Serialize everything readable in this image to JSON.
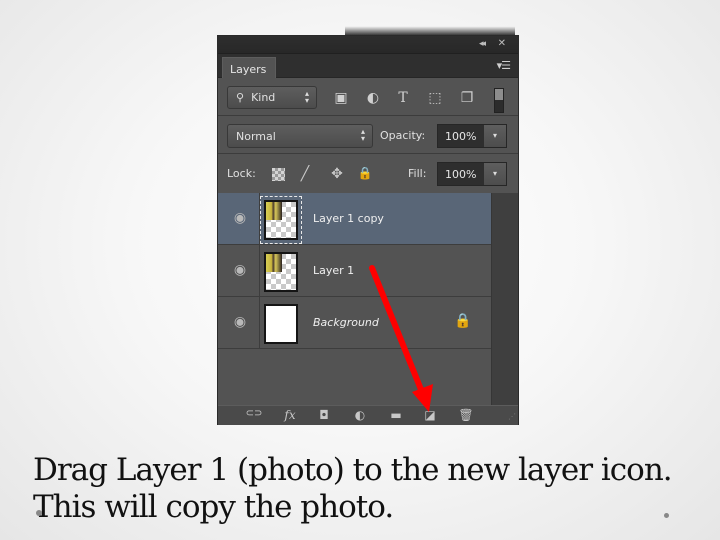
{
  "panel": {
    "title_bar": {
      "collapse_icon": "double-chevron-left-icon",
      "close_icon": "close-icon"
    },
    "tab_label": "Layers",
    "panel_menu_icon": "panel-menu-icon",
    "filter": {
      "kind_label": "Kind",
      "filter_icons": [
        "pixel-layer-filter-icon",
        "adjustment-layer-filter-icon",
        "type-layer-filter-icon",
        "shape-layer-filter-icon",
        "smart-object-filter-icon"
      ],
      "filter_toggle_on": true
    },
    "blend_mode": "Normal",
    "opacity_label": "Opacity:",
    "opacity_value": "100%",
    "lock_label": "Lock:",
    "lock_icons": [
      "lock-transparent-pixels-icon",
      "lock-image-pixels-icon",
      "lock-position-icon",
      "lock-all-icon"
    ],
    "fill_label": "Fill:",
    "fill_value": "100%",
    "layers": [
      {
        "name": "Layer 1 copy",
        "visible": true,
        "selected": true,
        "italic": false,
        "locked": false
      },
      {
        "name": "Layer 1",
        "visible": true,
        "selected": false,
        "italic": false,
        "locked": false
      },
      {
        "name": "Background",
        "visible": true,
        "selected": false,
        "italic": true,
        "locked": true
      }
    ],
    "bottom_icons": [
      "link-layers-icon",
      "layer-style-fx-icon",
      "add-mask-icon",
      "adjustment-layer-icon",
      "new-group-folder-icon",
      "new-layer-icon",
      "delete-layer-icon"
    ],
    "glyphs": {
      "collapse": "◂◂",
      "close": "✕",
      "menu": "▾☰",
      "magnifier": "⚲",
      "spin": "▴\n▾",
      "dropdown": "▾",
      "eye": "◉",
      "lock": "🔒",
      "brush": "╱",
      "move": "✥",
      "type": "T",
      "image": "▣",
      "circle": "◐",
      "shape": "⬚",
      "smart": "❐",
      "link": "⊂⊃",
      "fx": "fx",
      "mask": "◘",
      "folder": "▬",
      "newlayer": "◪",
      "trash": "🗑",
      "grip": "⋰"
    }
  },
  "annotation": {
    "color": "#ff0000",
    "from": "Layer 1",
    "to": "new-layer-icon"
  },
  "colors": {
    "selected_row": "#596677",
    "panel_bg": "#535353"
  },
  "caption": {
    "line1": "Drag Layer 1 (photo) to the new layer icon.",
    "line2": "This will copy the photo."
  }
}
